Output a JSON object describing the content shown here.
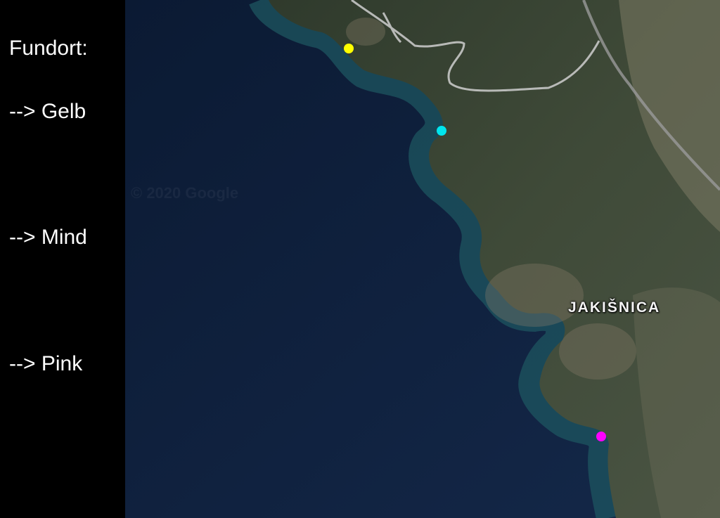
{
  "legend": {
    "title": "Fundort:",
    "items": [
      {
        "label": "--> Gelb",
        "color": "#ffff00"
      },
      {
        "label": "--> Mind",
        "color": "#00e5ee"
      },
      {
        "label": "--> Pink",
        "color": "#ff00ff"
      }
    ]
  },
  "map": {
    "place_label": "JAKIŠNICA",
    "watermark": "© 2020 Google",
    "markers": [
      {
        "name": "yellow-marker",
        "color": "#ffff00"
      },
      {
        "name": "cyan-marker",
        "color": "#00e5ee"
      },
      {
        "name": "magenta-marker",
        "color": "#ff00ff"
      }
    ]
  }
}
